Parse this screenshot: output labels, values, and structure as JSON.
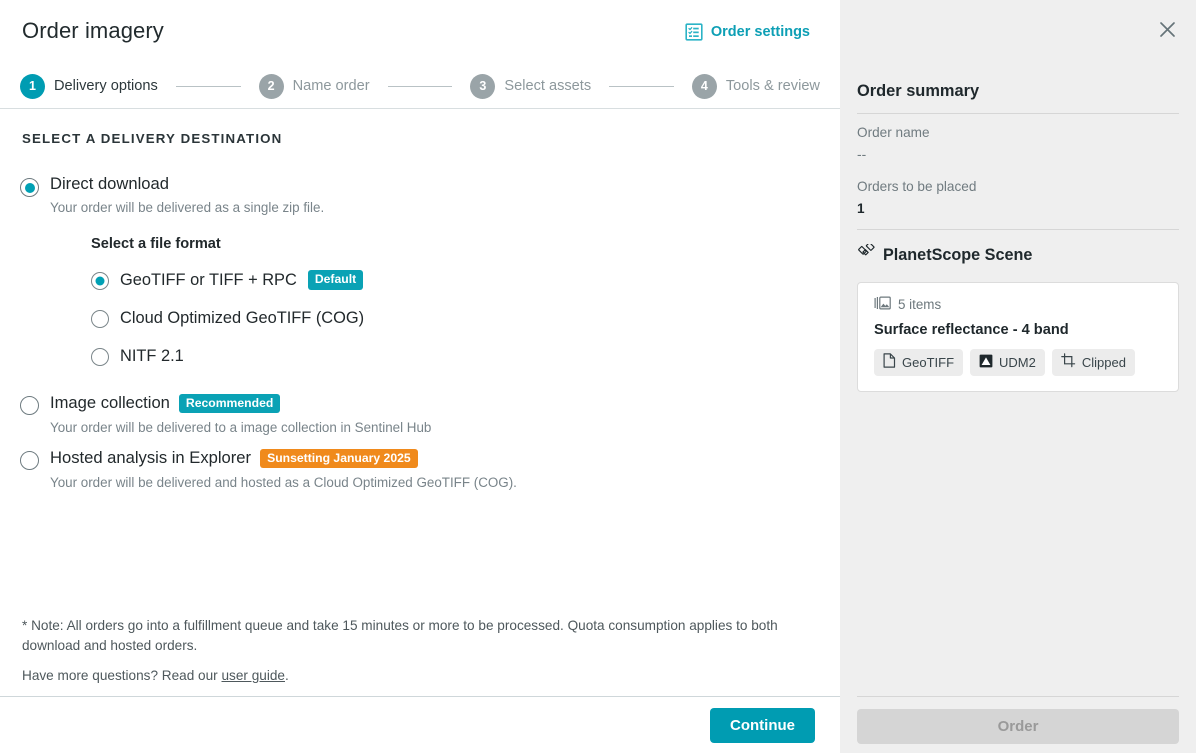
{
  "header": {
    "title": "Order imagery",
    "order_settings_label": "Order settings",
    "order_settings_icon": "checklist-box-icon",
    "close_icon": "close-icon",
    "accent_color": "#009cb2"
  },
  "stepper": {
    "steps": [
      {
        "number": "1",
        "label": "Delivery options",
        "active": true
      },
      {
        "number": "2",
        "label": "Name order",
        "active": false
      },
      {
        "number": "3",
        "label": "Select assets",
        "active": false
      },
      {
        "number": "4",
        "label": "Tools & review",
        "active": false
      }
    ]
  },
  "main": {
    "section_title": "SELECT A DELIVERY DESTINATION",
    "destinations": [
      {
        "label": "Direct download",
        "description": "Your order will be delivered as a single zip file.",
        "selected": true,
        "badge": null
      },
      {
        "label": "Image collection",
        "description": "Your order will be delivered to a image collection in Sentinel Hub",
        "selected": false,
        "badge": {
          "text": "Recommended",
          "color": "#0aa2b5"
        }
      },
      {
        "label": "Hosted analysis in Explorer",
        "description": "Your order will be delivered and hosted as a Cloud Optimized GeoTIFF (COG).",
        "selected": false,
        "badge": {
          "text": "Sunsetting January 2025",
          "color": "#f08a1c"
        }
      }
    ],
    "format": {
      "title": "Select a file format",
      "options": [
        {
          "label": "GeoTIFF or TIFF + RPC",
          "selected": true,
          "badge": {
            "text": "Default",
            "color": "#0aa2b5"
          }
        },
        {
          "label": "Cloud Optimized GeoTIFF (COG)",
          "selected": false,
          "badge": null
        },
        {
          "label": "NITF 2.1",
          "selected": false,
          "badge": null
        }
      ]
    },
    "note": "* Note: All orders go into a fulfillment queue and take 15 minutes or more to be processed. Quota consumption applies to both download and hosted orders.",
    "questions_prefix": "Have more questions? Read our ",
    "questions_link": "user guide",
    "questions_suffix": ".",
    "continue_label": "Continue"
  },
  "sidebar": {
    "title": "Order summary",
    "order_name_key": "Order name",
    "order_name_value": "--",
    "orders_key": "Orders to be placed",
    "orders_value": "1",
    "product_icon": "satellite-icon",
    "product_name": "PlanetScope Scene",
    "item": {
      "count_icon": "image-stack-icon",
      "count_label": "5 items",
      "name": "Surface reflectance - 4 band",
      "chips": [
        {
          "label": "GeoTIFF",
          "icon": "file-icon"
        },
        {
          "label": "UDM2",
          "icon": "mask-image-icon"
        },
        {
          "label": "Clipped",
          "icon": "crop-icon"
        }
      ]
    },
    "order_button_label": "Order"
  }
}
